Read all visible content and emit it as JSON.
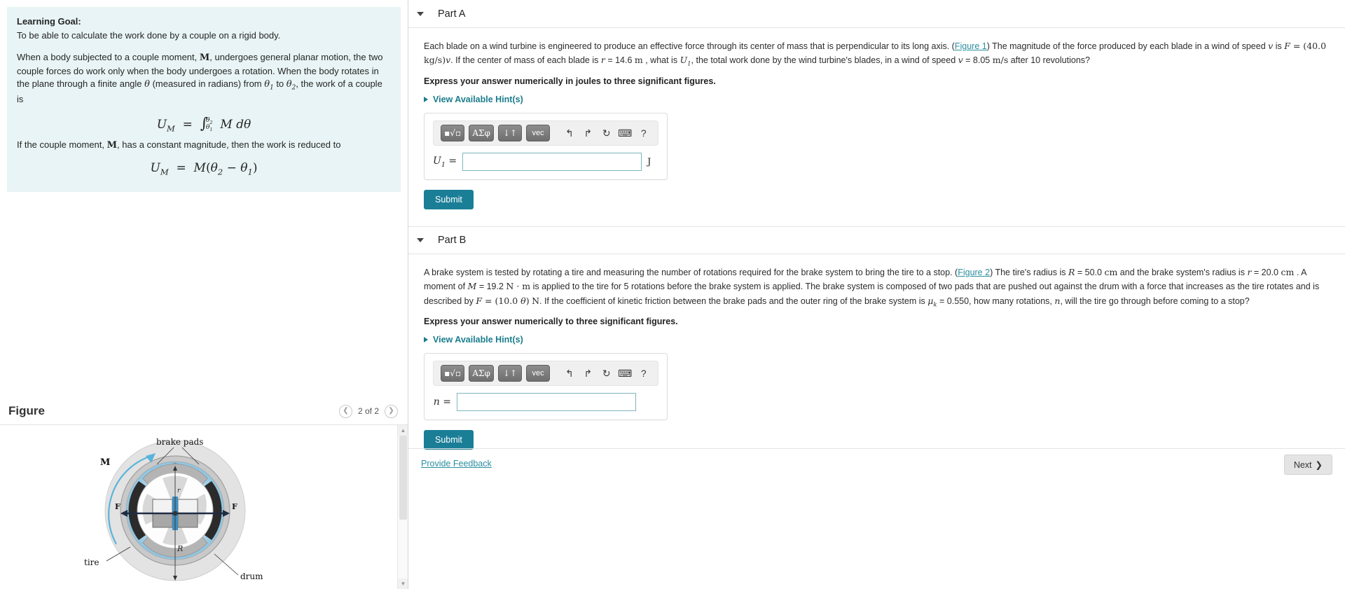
{
  "left": {
    "learning_goal": {
      "title": "Learning Goal:",
      "subtitle": "To be able to calculate the work done by a couple on a rigid body.",
      "para_1a": "When a body subjected to a couple moment, ",
      "para_1b": ", undergoes general planar motion, the two couple forces do work only when the body undergoes a rotation.  When the body rotates in the plane through a finite angle ",
      "para_1c": " (measured in radians) from ",
      "para_1d": " to ",
      "para_1e": ", the work of a couple is",
      "moment_symbol": "M",
      "theta": "θ",
      "theta1": "θ",
      "theta1_sub": "1",
      "theta2": "θ",
      "theta2_sub": "2",
      "formula_1": "U_M = ∫ M dθ",
      "para_2a": "If the couple moment, ",
      "para_2b": ", has a constant magnitude, then the work is reduced to",
      "formula_2": "U_M = M(θ₂ − θ₁)"
    },
    "figure": {
      "title": "Figure",
      "pager_label": "2 of 2",
      "prev_icon": "chevron-left-icon",
      "next_icon": "chevron-right-icon",
      "diagram_labels": {
        "brake_pads": "brake pads",
        "moment": "M",
        "force_left": "F",
        "force_right": "F",
        "radius_inner": "r",
        "radius_outer": "R",
        "tire": "tire",
        "drum": "drum"
      }
    }
  },
  "parts": [
    {
      "id": "part-a",
      "label": "Part A",
      "caret_icon": "caret-down-icon",
      "problem_segments": [
        {
          "t": "text",
          "v": "Each blade on a wind turbine is engineered to produce an effective force through its center of mass that is perpendicular to its long axis. ("
        },
        {
          "t": "link",
          "v": "Figure 1"
        },
        {
          "t": "text",
          "v": ") The magnitude of the force produced by each blade in a wind of speed "
        },
        {
          "t": "mathi",
          "v": "v"
        },
        {
          "t": "text",
          "v": " is "
        },
        {
          "t": "math",
          "v": "F = (40.0 kg/s)v"
        },
        {
          "t": "text",
          "v": ".  If the center of mass of each blade is "
        },
        {
          "t": "mathi",
          "v": "r"
        },
        {
          "t": "text",
          "v": " = 14.6 "
        },
        {
          "t": "mathr",
          "v": "m"
        },
        {
          "t": "text",
          "v": " , what is "
        },
        {
          "t": "mathi",
          "v": "U₁"
        },
        {
          "t": "text",
          "v": ", the total work done by the wind turbine's blades, in a wind of speed "
        },
        {
          "t": "mathi",
          "v": "v"
        },
        {
          "t": "text",
          "v": " = 8.05 "
        },
        {
          "t": "mathr",
          "v": "m/s"
        },
        {
          "t": "text",
          "v": " after 10 revolutions?"
        }
      ],
      "express": "Express your answer numerically in joules to three significant figures.",
      "hint_label": "View Available Hint(s)",
      "answer_label": "U",
      "answer_label_sub": "1",
      "answer_value": "",
      "answer_unit": "J",
      "submit_label": "Submit"
    },
    {
      "id": "part-b",
      "label": "Part B",
      "caret_icon": "caret-down-icon",
      "express": "Express your answer numerically to three significant figures.",
      "hint_label": "View Available Hint(s)",
      "answer_label": "n",
      "answer_label_sub": "",
      "answer_value": "",
      "answer_unit": "",
      "submit_label": "Submit"
    }
  ],
  "part_b_text": {
    "s1": "A brake system is tested by rotating a tire and measuring the number of rotations required for the brake system to bring the tire to a stop. (",
    "link1": "Figure 2",
    "s2": ") The tire's radius is ",
    "R": "R",
    "s3": " = 50.0 ",
    "cm1": "cm",
    "s4": " and the brake system's radius is ",
    "r": "r",
    "s5": " = 20.0 ",
    "cm2": "cm",
    "s6": " . A moment of ",
    "M": "M",
    "s7": " = 19.2 ",
    "Nm": "N · m",
    "s8": " is applied to the tire for 5 rotations before the brake system is applied.  The brake system is composed of two pads that are pushed out against the drum with a force that increases as the tire rotates and is described by ",
    "F": "F = (10.0 θ)",
    "Nunit": "N",
    "s9": ".  If the coefficient of kinetic friction between the brake pads and the outer ring of the brake system is ",
    "muk": "μ",
    "muk_sub": "k",
    "s10": " = 0.550, how many rotations, ",
    "n": "n",
    "s11": ", will the tire go through before coming to a stop?"
  },
  "toolbar": {
    "buttons": [
      {
        "name": "template-button",
        "label": "▪√▫"
      },
      {
        "name": "greek-symbols-button",
        "label": "ΑΣφ"
      },
      {
        "name": "arrows-button",
        "label": "↓↑"
      },
      {
        "name": "vector-button",
        "label": "vec"
      }
    ],
    "icons": [
      {
        "name": "undo-icon",
        "glyph": "↰"
      },
      {
        "name": "redo-icon",
        "glyph": "↱"
      },
      {
        "name": "reset-icon",
        "glyph": "↻"
      },
      {
        "name": "keyboard-icon",
        "glyph": "⌨"
      },
      {
        "name": "help-icon",
        "glyph": "?"
      }
    ]
  },
  "footer": {
    "feedback_label": "Provide Feedback",
    "next_label": "Next",
    "next_icon": "chevron-right-icon"
  },
  "colors": {
    "accent_teal": "#1a7e96",
    "link_teal": "#2a8fa0",
    "panel_bg": "#e8f4f5",
    "input_border": "#7fb6bd"
  }
}
